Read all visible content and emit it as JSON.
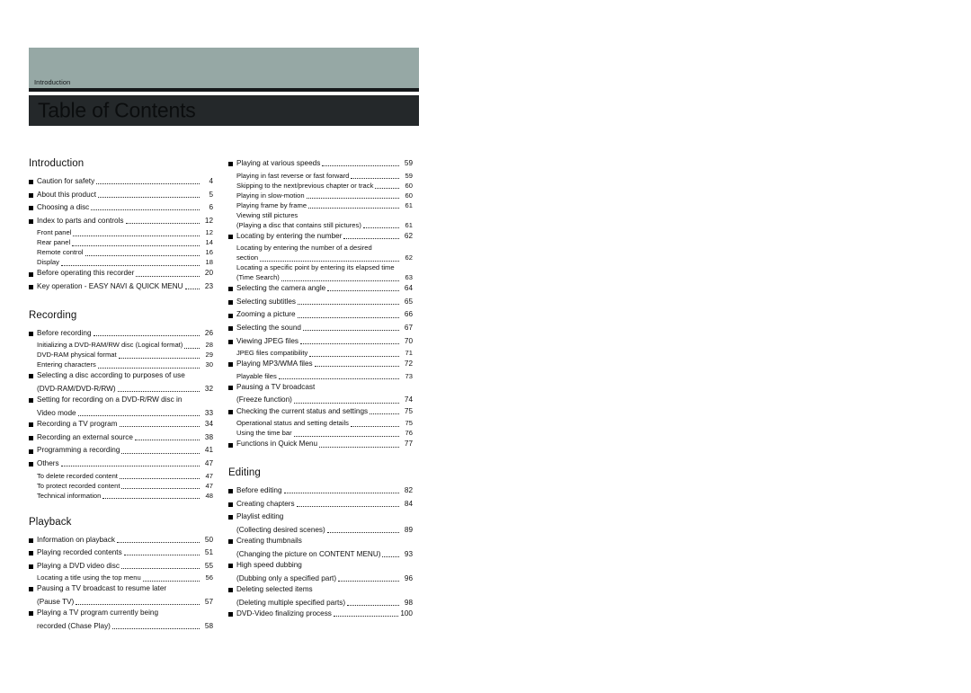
{
  "header": {
    "tab_label": "Introduction",
    "title": "Table of Contents",
    "sage_color": "#96a8a5",
    "dark_color": "#24282a"
  },
  "left_column": {
    "sections": [
      {
        "heading": "Introduction",
        "entries": [
          {
            "level": "main",
            "text": "Caution for safety",
            "page": "4"
          },
          {
            "level": "main",
            "text": "About this product",
            "page": "5"
          },
          {
            "level": "main",
            "text": "Choosing a disc",
            "page": "6"
          },
          {
            "level": "main",
            "text": "Index to parts and controls",
            "page": "12"
          },
          {
            "level": "sub",
            "text": "Front panel",
            "page": "12"
          },
          {
            "level": "sub",
            "text": "Rear panel",
            "page": "14"
          },
          {
            "level": "sub",
            "text": "Remote control",
            "page": "16"
          },
          {
            "level": "sub",
            "text": "Display",
            "page": "18"
          },
          {
            "level": "main",
            "text": "Before operating this recorder",
            "page": "20"
          },
          {
            "level": "main",
            "text": "Key operation - EASY NAVI & QUICK MENU",
            "page": "23"
          }
        ]
      },
      {
        "heading": "Recording",
        "entries": [
          {
            "level": "main",
            "text": "Before recording",
            "page": "26"
          },
          {
            "level": "sub",
            "text": "Initializing a DVD-RAM/RW disc (Logical format)",
            "page": "28"
          },
          {
            "level": "sub",
            "text": "DVD-RAM physical format",
            "page": "29"
          },
          {
            "level": "sub",
            "text": "Entering characters",
            "page": "30"
          },
          {
            "level": "main",
            "text": "Selecting a disc according to purposes of use",
            "page": ""
          },
          {
            "level": "cont",
            "text": "(DVD-RAM/DVD-R/RW)",
            "page": "32"
          },
          {
            "level": "main",
            "text": "Setting for recording on a DVD-R/RW disc in",
            "page": ""
          },
          {
            "level": "cont",
            "text": "Video mode",
            "page": "33"
          },
          {
            "level": "main",
            "text": "Recording a TV program",
            "page": "34"
          },
          {
            "level": "main",
            "text": "Recording an external source",
            "page": "38"
          },
          {
            "level": "main",
            "text": "Programming a recording",
            "page": "41"
          },
          {
            "level": "main",
            "text": "Others",
            "page": "47"
          },
          {
            "level": "sub",
            "text": "To delete recorded content",
            "page": "47"
          },
          {
            "level": "sub",
            "text": "To protect recorded content",
            "page": "47"
          },
          {
            "level": "sub",
            "text": "Technical information",
            "page": "48"
          }
        ]
      },
      {
        "heading": "Playback",
        "entries": [
          {
            "level": "main",
            "text": "Information on playback",
            "page": "50"
          },
          {
            "level": "main",
            "text": "Playing recorded contents",
            "page": "51"
          },
          {
            "level": "main",
            "text": "Playing a DVD video disc",
            "page": "55"
          },
          {
            "level": "sub",
            "text": "Locating a title using the top menu",
            "page": "56"
          },
          {
            "level": "main",
            "text": "Pausing a TV broadcast to resume later",
            "page": ""
          },
          {
            "level": "cont",
            "text": "(Pause TV)",
            "page": "57"
          },
          {
            "level": "main",
            "text": "Playing a TV program currently being",
            "page": ""
          },
          {
            "level": "cont",
            "text": "recorded (Chase Play)",
            "page": "58"
          }
        ]
      }
    ]
  },
  "right_column": {
    "sections": [
      {
        "heading": "",
        "entries": [
          {
            "level": "main",
            "text": "Playing at various speeds",
            "page": "59"
          },
          {
            "level": "sub",
            "text": "Playing in fast reverse or fast forward",
            "page": "59"
          },
          {
            "level": "sub",
            "text": "Skipping to the next/previous chapter or track",
            "page": "60"
          },
          {
            "level": "sub",
            "text": "Playing in slow-motion",
            "page": "60"
          },
          {
            "level": "sub",
            "text": "Playing frame by frame",
            "page": "61"
          },
          {
            "level": "sub-nopage",
            "text": "Viewing still pictures",
            "page": ""
          },
          {
            "level": "sub",
            "text": "(Playing a disc that contains still pictures)",
            "page": "61"
          },
          {
            "level": "main",
            "text": "Locating by entering the number",
            "page": "62"
          },
          {
            "level": "sub-nopage",
            "text": "Locating by entering the number of a desired",
            "page": ""
          },
          {
            "level": "sub",
            "text": "section",
            "page": "62"
          },
          {
            "level": "sub-nopage",
            "text": "Locating a specific point by entering its elapsed time",
            "page": ""
          },
          {
            "level": "sub",
            "text": "(Time Search)",
            "page": "63"
          },
          {
            "level": "main",
            "text": "Selecting the camera angle",
            "page": "64"
          },
          {
            "level": "main",
            "text": "Selecting subtitles",
            "page": "65"
          },
          {
            "level": "main",
            "text": "Zooming a picture",
            "page": "66"
          },
          {
            "level": "main",
            "text": "Selecting the sound",
            "page": "67"
          },
          {
            "level": "main",
            "text": "Viewing JPEG files",
            "page": "70"
          },
          {
            "level": "sub",
            "text": "JPEG files compatibility",
            "page": "71"
          },
          {
            "level": "main",
            "text": "Playing MP3/WMA files",
            "page": "72"
          },
          {
            "level": "sub",
            "text": "Playable files",
            "page": "73"
          },
          {
            "level": "main",
            "text": "Pausing a TV broadcast",
            "page": ""
          },
          {
            "level": "cont",
            "text": "(Freeze function)",
            "page": "74"
          },
          {
            "level": "main",
            "text": "Checking the current status and settings",
            "page": "75"
          },
          {
            "level": "sub",
            "text": "Operational status and setting details",
            "page": "75"
          },
          {
            "level": "sub",
            "text": "Using the time bar",
            "page": "76"
          },
          {
            "level": "main",
            "text": "Functions in Quick Menu",
            "page": "77"
          }
        ]
      },
      {
        "heading": "Editing",
        "entries": [
          {
            "level": "main",
            "text": "Before editing",
            "page": "82"
          },
          {
            "level": "main",
            "text": "Creating chapters",
            "page": "84"
          },
          {
            "level": "main",
            "text": "Playlist editing",
            "page": ""
          },
          {
            "level": "cont",
            "text": "(Collecting desired scenes)",
            "page": "89"
          },
          {
            "level": "main",
            "text": "Creating thumbnails",
            "page": ""
          },
          {
            "level": "cont",
            "text": "(Changing the picture on CONTENT MENU)",
            "page": "93"
          },
          {
            "level": "main",
            "text": "High speed dubbing",
            "page": ""
          },
          {
            "level": "cont",
            "text": "(Dubbing only a specified part)",
            "page": "96"
          },
          {
            "level": "main",
            "text": "Deleting selected items",
            "page": ""
          },
          {
            "level": "cont",
            "text": "(Deleting multiple specified parts)",
            "page": "98"
          },
          {
            "level": "main",
            "text": "DVD-Video finalizing process",
            "page": "100"
          }
        ]
      }
    ]
  }
}
